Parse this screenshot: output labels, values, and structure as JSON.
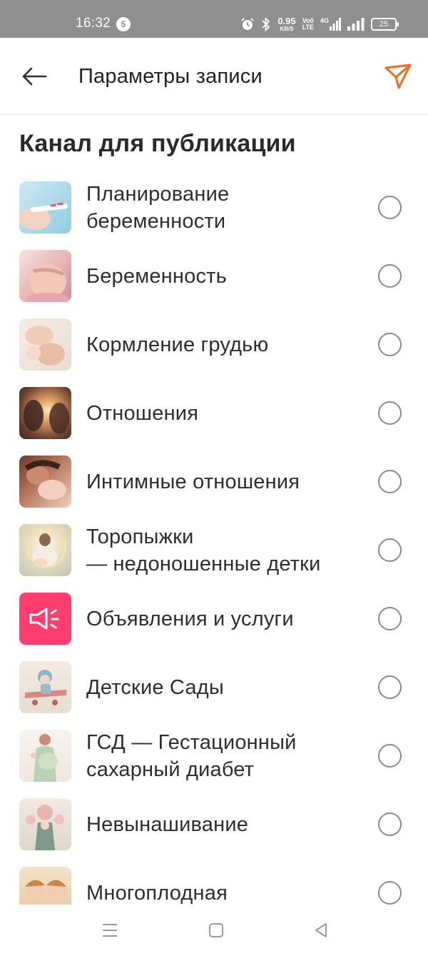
{
  "status_bar": {
    "time": "16:32",
    "notification_count": "5",
    "net_speed_value": "0.95",
    "net_speed_unit": "KB/S",
    "volte_top": "Vo0",
    "volte_bottom": "LTE",
    "signal_label": "4G",
    "battery": "25",
    "icons": [
      "alarm-icon",
      "bluetooth-icon",
      "signal-4g-icon",
      "signal-icon",
      "battery-icon"
    ]
  },
  "toolbar": {
    "title": "Параметры записи",
    "back_icon": "arrow-left-icon",
    "send_icon": "send-icon",
    "accent_color": "#f46a1f"
  },
  "section": {
    "title": "Канал для публикации"
  },
  "channels": [
    {
      "label": "Планирование\nбеременности",
      "selected": false,
      "thumb": "pregnancy-test-image"
    },
    {
      "label": "Беременность",
      "selected": false,
      "thumb": "pregnant-belly-image"
    },
    {
      "label": "Кормление грудью",
      "selected": false,
      "thumb": "breastfeeding-image"
    },
    {
      "label": "Отношения",
      "selected": false,
      "thumb": "couple-sunset-image"
    },
    {
      "label": "Интимные отношения",
      "selected": false,
      "thumb": "intimate-couple-image"
    },
    {
      "label": "Торопыжки\n— недоношенные детки",
      "selected": false,
      "thumb": "premature-baby-image"
    },
    {
      "label": "Объявления и услуги",
      "selected": false,
      "thumb": "megaphone-icon",
      "thumb_color": "#ff3d6e"
    },
    {
      "label": "Детские Сады",
      "selected": false,
      "thumb": "child-airplane-image"
    },
    {
      "label": "ГСД — Гестационный\nсахарный диабет",
      "selected": false,
      "thumb": "pregnant-woman-illustration"
    },
    {
      "label": "Невынашивание",
      "selected": false,
      "thumb": "flower-figure-image"
    },
    {
      "label": "Многоплодная",
      "selected": false,
      "thumb": "twins-image"
    }
  ],
  "nav_bar": {
    "icons": [
      "menu-icon",
      "home-icon",
      "back-triangle-icon"
    ]
  }
}
